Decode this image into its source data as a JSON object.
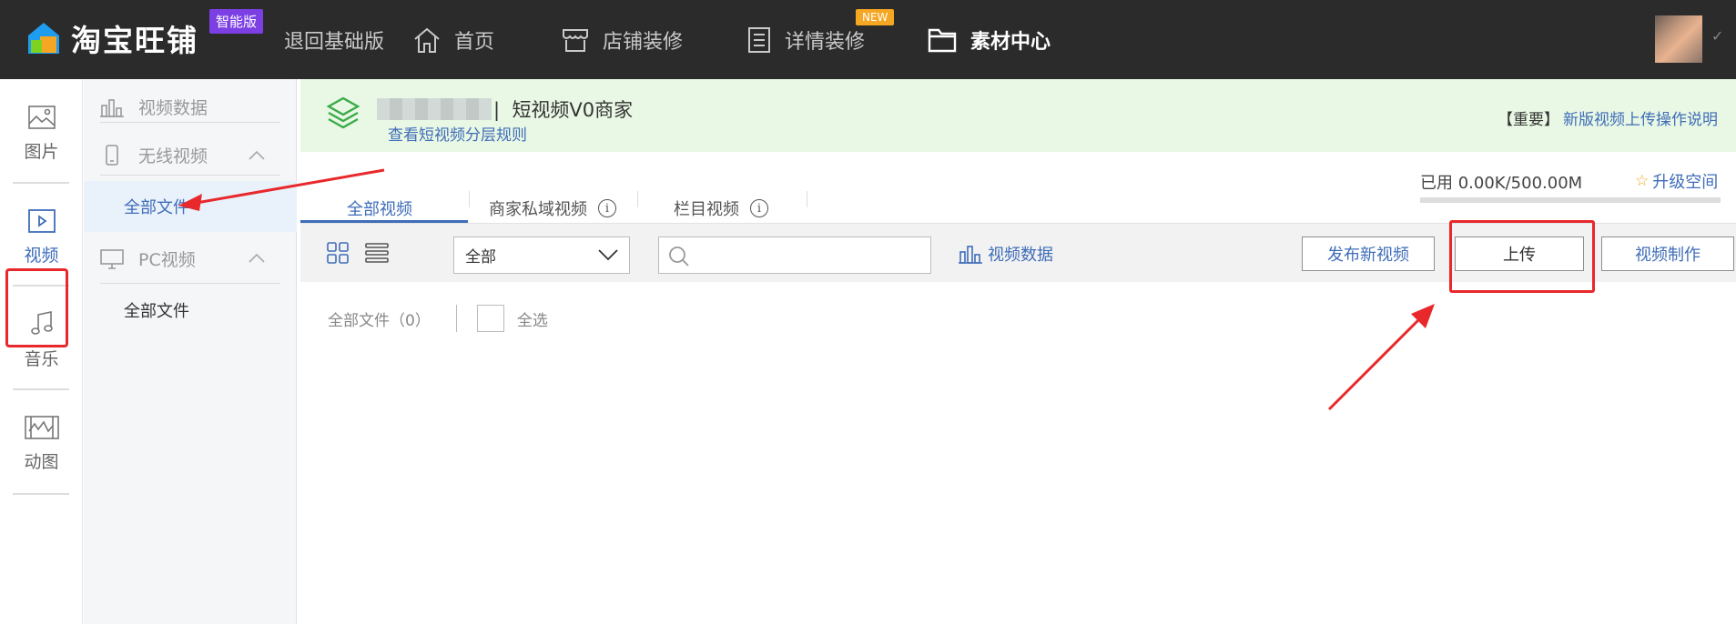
{
  "app": {
    "logo_text": "淘宝旺铺",
    "edition_badge": "智能版",
    "back_to_basic": "退回基础版",
    "new_badge": "NEW"
  },
  "nav": [
    {
      "label": "首页",
      "icon": "home-icon"
    },
    {
      "label": "店铺装修",
      "icon": "store-icon"
    },
    {
      "label": "详情装修",
      "icon": "document-icon"
    },
    {
      "label": "素材中心",
      "icon": "folder-icon",
      "active": true
    }
  ],
  "rail": [
    {
      "label": "图片",
      "icon": "image-icon"
    },
    {
      "label": "视频",
      "icon": "video-icon",
      "active": true
    },
    {
      "label": "音乐",
      "icon": "music-icon"
    },
    {
      "label": "动图",
      "icon": "gif-icon"
    }
  ],
  "sidebar": {
    "video_data": "视频数据",
    "wireless_video": "无线视频",
    "wireless_all_files": "全部文件",
    "pc_video": "PC视频",
    "pc_all_files": "全部文件"
  },
  "banner": {
    "title_sep": "|",
    "title": "短视频V0商家",
    "link": "查看短视频分层规则",
    "important_prefix": "【重要】",
    "important_link": "新版视频上传操作说明"
  },
  "tabs": [
    {
      "label": "全部视频",
      "active": true
    },
    {
      "label": "商家私域视频",
      "info": true
    },
    {
      "label": "栏目视频",
      "info": true
    }
  ],
  "quota": {
    "text": "已用 0.00K/500.00M",
    "used_fraction": 0.0,
    "upgrade": "升级空间"
  },
  "toolbar": {
    "filter_value": "全部",
    "search_placeholder": "",
    "video_data_link": "视频数据",
    "publish_button": "发布新视频",
    "upload_button": "上传",
    "make_button": "视频制作"
  },
  "files": {
    "all_files_label": "全部文件（0）",
    "select_all": "全选"
  },
  "colors": {
    "accent": "#3f6db8",
    "topbar": "#2b2b2b",
    "banner_bg": "#e9f8e4",
    "annotation_red": "#e8282b",
    "badge_purple": "#7b3fe4",
    "badge_orange": "#f5a623"
  }
}
